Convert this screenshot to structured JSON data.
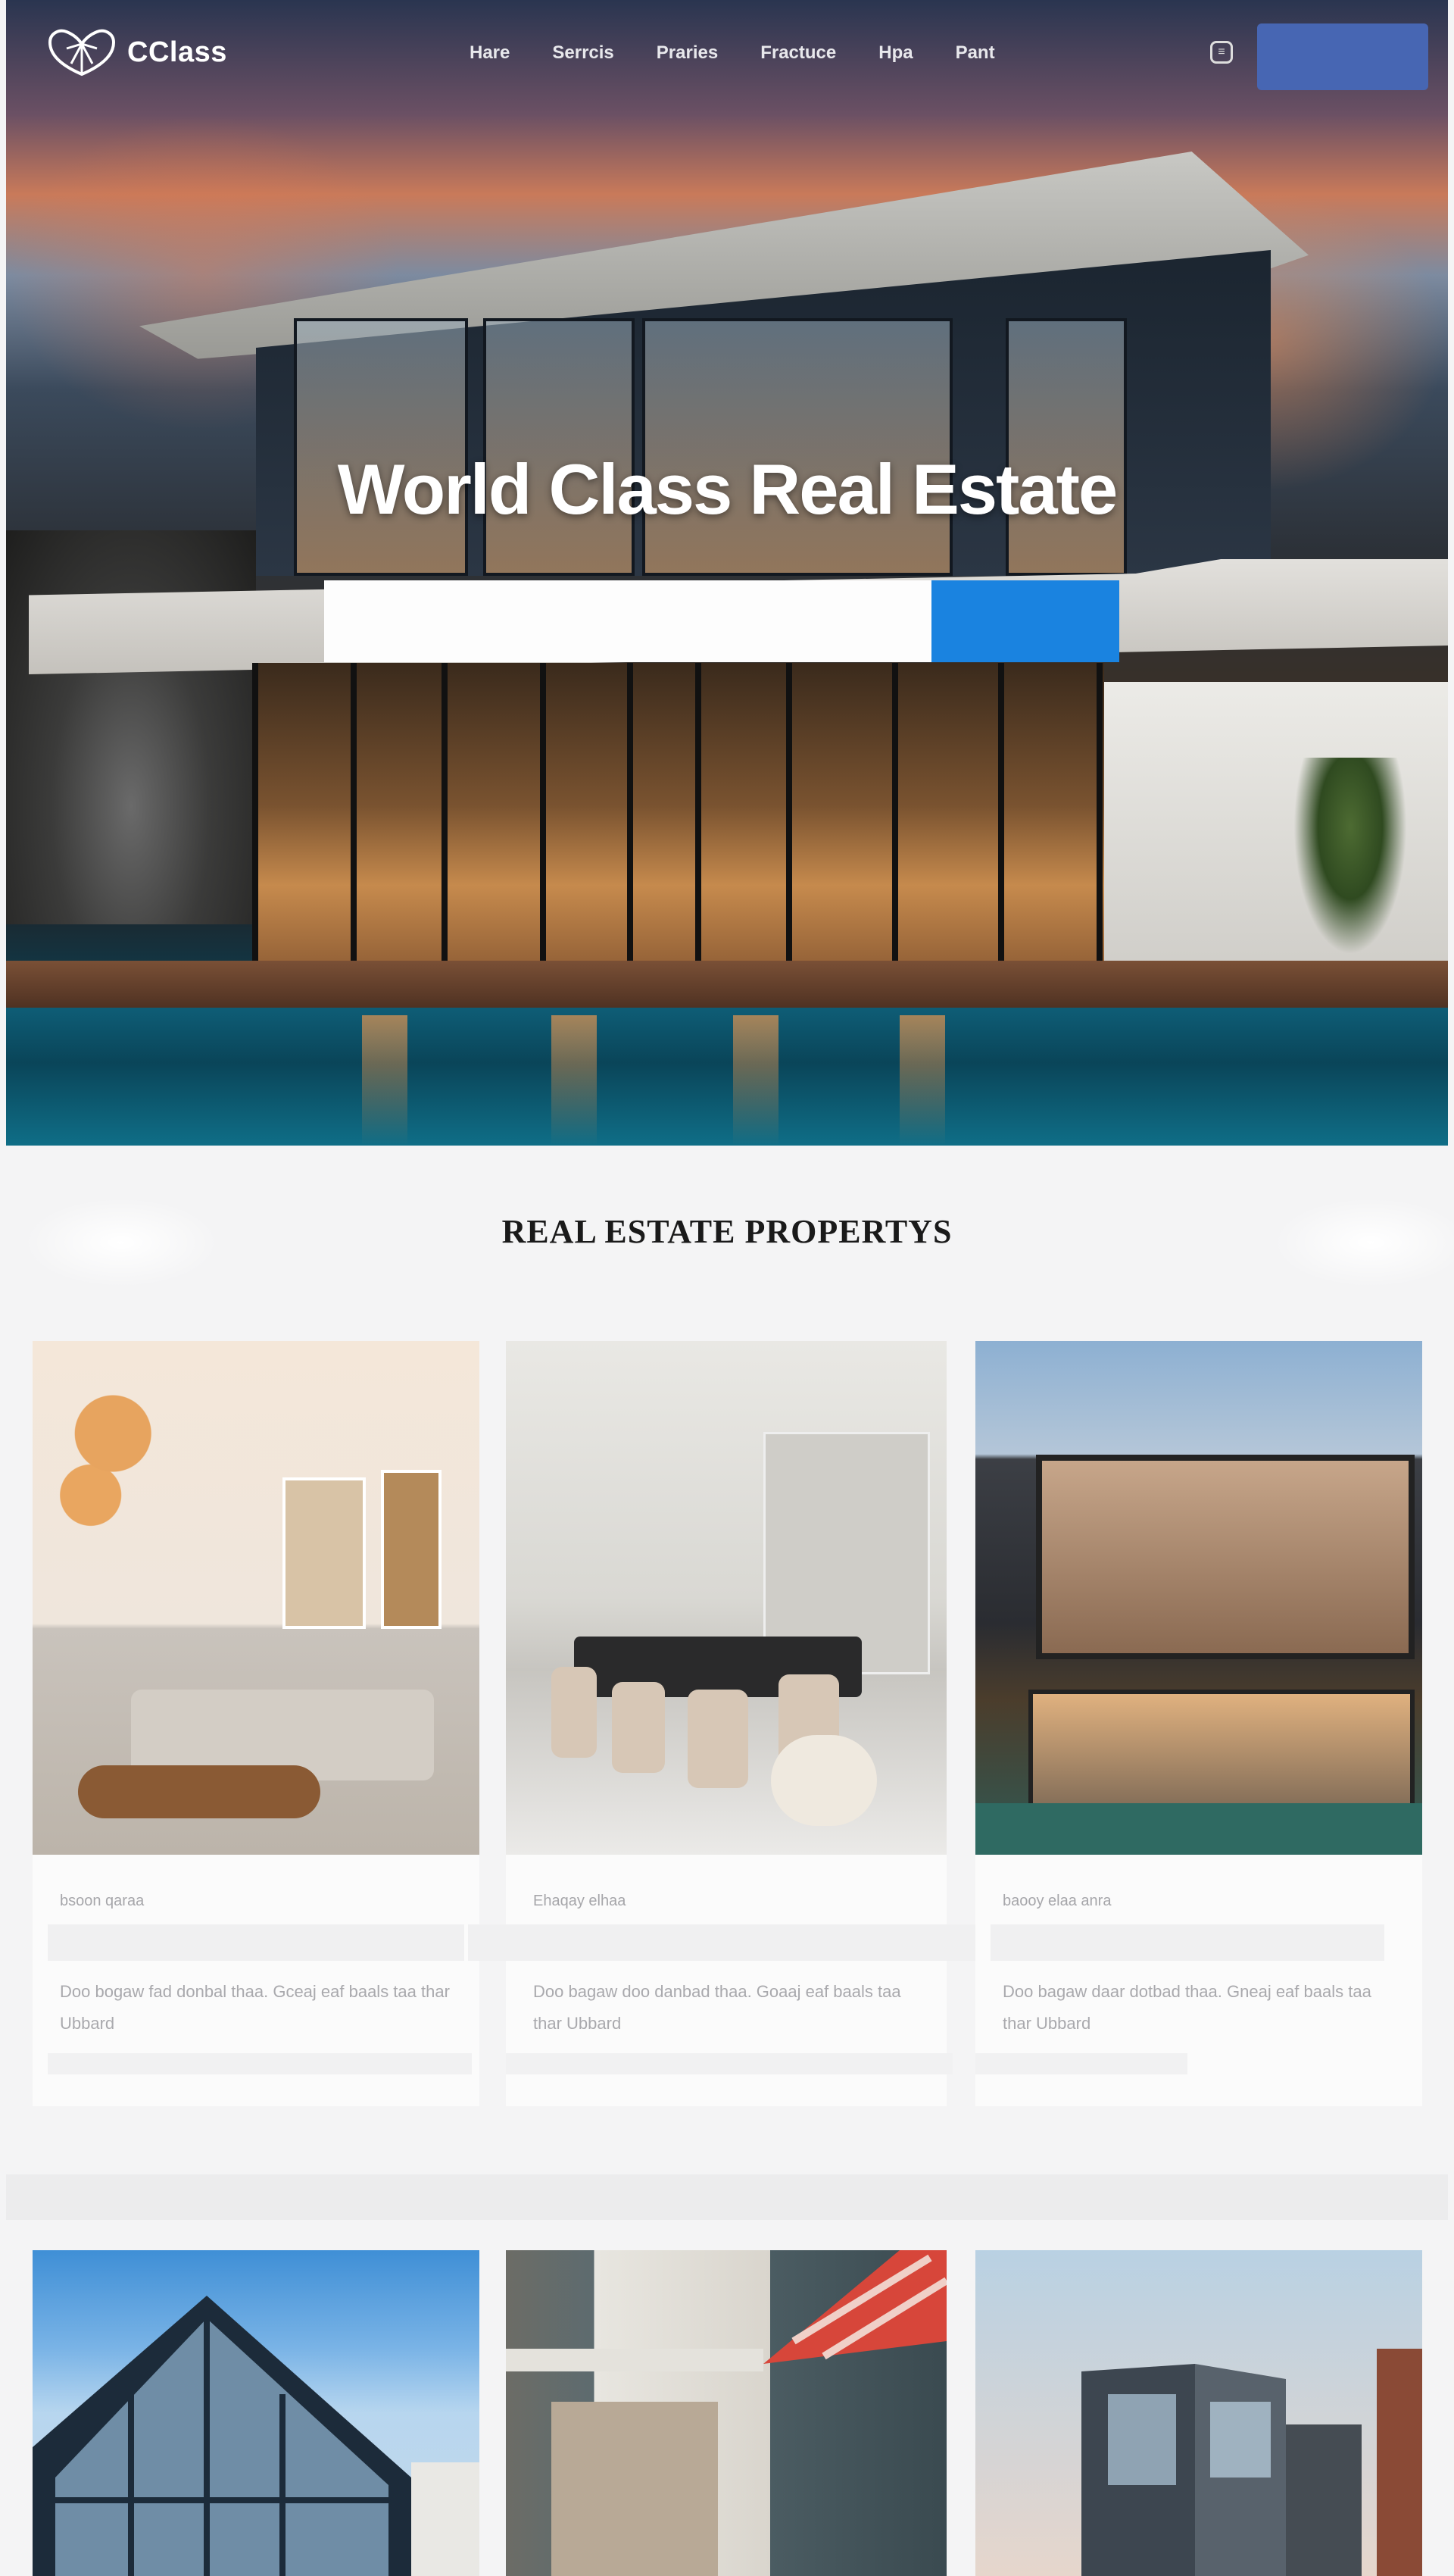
{
  "brand": {
    "logo_text": "CClass"
  },
  "nav": {
    "links": [
      "Hare",
      "Serrcis",
      "Praries",
      "Fractuce",
      "Hpa",
      "Pant"
    ],
    "cta_label": ""
  },
  "hero": {
    "title": "World Class Real Estate",
    "search_placeholder": "",
    "search_button_label": ""
  },
  "listings": {
    "heading": "REAL ESTATE PROPERTYS",
    "cards": [
      {
        "meta": "bsoon qaraa",
        "description": "Doo bogaw fad donbal thaa. Gceaj eaf baals taa thar Ubbard"
      },
      {
        "meta": "Ehaqay elhaa",
        "description": "Doo bagaw doo danbad thaa. Goaaj eaf baals taa thar Ubbard"
      },
      {
        "meta": "baooy elaa anra",
        "description": "Doo bagaw daar dotbad thaa. Gneaj eaf baals taa thar Ubbard"
      }
    ]
  },
  "colors": {
    "nav_cta": "#4766b3",
    "search_button": "#1a83e0",
    "page_bg": "#f4f4f5"
  },
  "icons": {
    "nav_icon": "chat-icon",
    "logo_icon": "globe-logo-icon"
  }
}
